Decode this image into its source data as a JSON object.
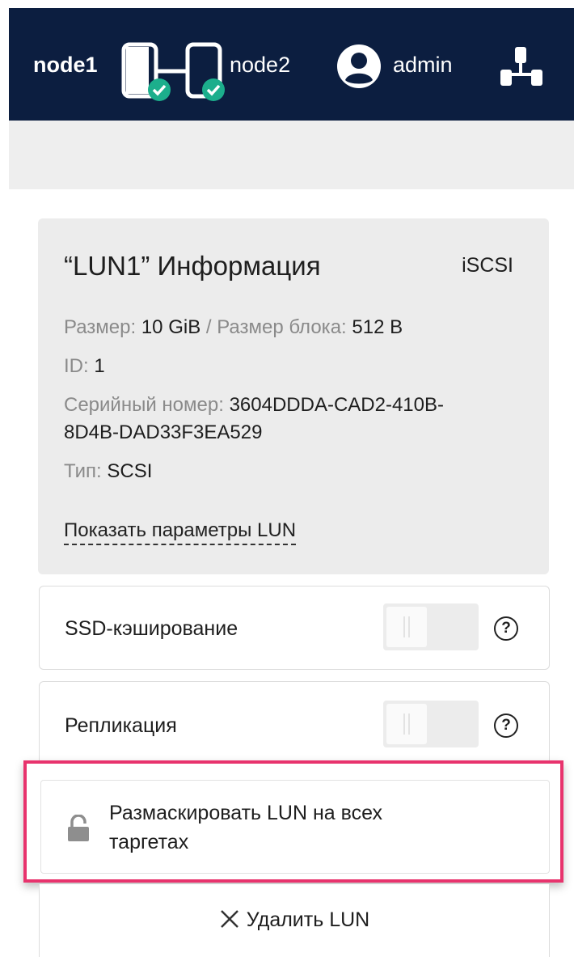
{
  "header": {
    "node1": "node1",
    "node2": "node2",
    "user": "admin",
    "colors": {
      "background": "#0c1e40",
      "status_ok": "#1cae8c"
    }
  },
  "lun_info": {
    "title": "“LUN1” Информация",
    "protocol": "iSCSI",
    "size_label": "Размер:",
    "size_value": "10 GiB",
    "separator": "/",
    "block_label": "Размер блока:",
    "block_value": "512 B",
    "id_label": "ID:",
    "id_value": "1",
    "serial_label": "Серийный номер:",
    "serial_value_line1": "3604DDDA-CAD2-410B-",
    "serial_value_line2": "8D4B-DAD33F3EA529",
    "type_label": "Тип:",
    "type_value": "SCSI",
    "show_params": "Показать параметры LUN"
  },
  "settings": {
    "ssd_cache": {
      "label": "SSD-кэширование",
      "enabled": false
    },
    "replication": {
      "label": "Репликация",
      "enabled": false
    },
    "help_glyph": "?"
  },
  "unmask": {
    "line1": "Размаскировать LUN на всех",
    "line2": "таргетах",
    "icon": "lock-icon",
    "highlight_color": "#e8336d"
  },
  "delete": {
    "label": "Удалить LUN",
    "icon": "close-icon"
  }
}
